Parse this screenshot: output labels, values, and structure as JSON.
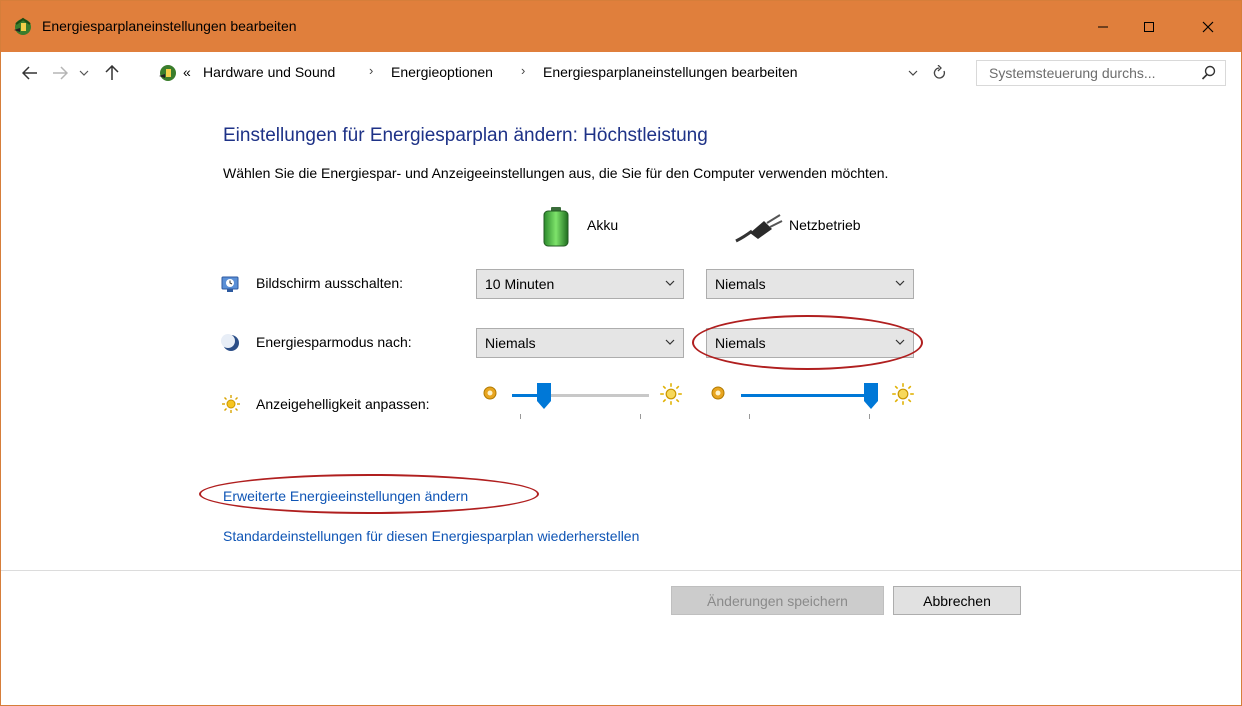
{
  "window": {
    "title": "Energiesparplaneinstellungen bearbeiten",
    "controls": {
      "minimize": "minimize",
      "maximize": "maximize",
      "close": "close"
    },
    "titlebar_color": "#e07f3c"
  },
  "address": {
    "overflow": "«",
    "breadcrumbs": [
      "Hardware und Sound",
      "Energieoptionen",
      "Energiesparplaneinstellungen bearbeiten"
    ],
    "separator": "›",
    "search_placeholder": "Systemsteuerung durchs..."
  },
  "main": {
    "heading": "Einstellungen für Energiesparplan ändern: Höchstleistung",
    "description": "Wählen Sie die Energiespar- und Anzeigeeinstellungen aus, die Sie für den Computer verwenden möchten.",
    "columns": {
      "battery": "Akku",
      "plugged": "Netzbetrieb"
    },
    "rows": [
      {
        "label": "Bildschirm ausschalten:",
        "battery_value": "10 Minuten",
        "plugged_value": "Niemals",
        "icon": "monitor-clock-icon"
      },
      {
        "label": "Energiesparmodus nach:",
        "battery_value": "Niemals",
        "plugged_value": "Niemals",
        "icon": "moon-icon"
      },
      {
        "label": "Anzeigehelligkeit anpassen:",
        "icon": "sun-icon",
        "battery_brightness": 0.2,
        "plugged_brightness": 1.0
      }
    ],
    "links": {
      "advanced": "Erweiterte Energieeinstellungen ändern",
      "restore": "Standardeinstellungen für diesen Energiesparplan wiederherstellen"
    }
  },
  "footer": {
    "save": "Änderungen speichern",
    "cancel": "Abbrechen"
  },
  "colors": {
    "heading": "#1e3287",
    "link": "#0f55b5",
    "slider_thumb": "#0078d7",
    "annotation": "#b01f1f"
  }
}
